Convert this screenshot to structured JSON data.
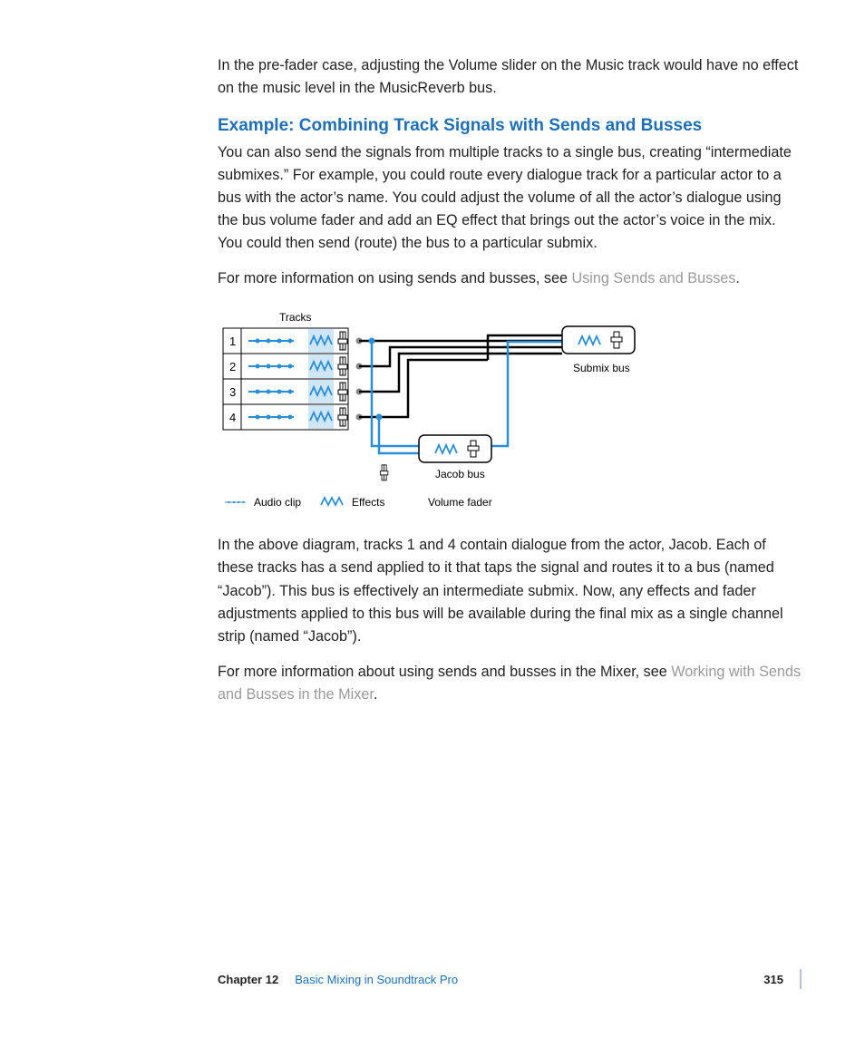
{
  "intro_para": "In the pre-fader case, adjusting the Volume slider on the Music track would have no effect on the music level in the MusicReverb bus.",
  "section_title": "Example: Combining Track Signals with Sends and Busses",
  "para1": "You can also send the signals from multiple tracks to a single bus, creating “intermediate submixes.” For example, you could route every dialogue track for a particular actor to a bus with the actor’s name. You could adjust the volume of all the actor’s dialogue using the bus volume fader and add an EQ effect that brings out the actor’s voice in the mix. You could then send (route) the bus to a particular submix.",
  "para2_a": "For more information on using sends and busses, see ",
  "para2_link": "Using Sends and Busses",
  "para3": "In the above diagram, tracks 1 and 4 contain dialogue from the actor, Jacob. Each of these tracks has a send applied to it that taps the signal and routes it to a bus (named “Jacob”). This bus is effectively an intermediate submix. Now, any effects and fader adjustments applied to this bus will be available during the final mix as a single channel strip (named “Jacob”).",
  "para4_a": "For more information about using sends and busses in the Mixer, see ",
  "para4_link": "Working with Sends and Busses in the Mixer",
  "diagram": {
    "tracks_label": "Tracks",
    "track_numbers": [
      "1",
      "2",
      "3",
      "4"
    ],
    "submix_label": "Submix bus",
    "jacob_label": "Jacob bus",
    "legend": {
      "audio": "Audio clip",
      "effects": "Effects",
      "fader": "Volume fader"
    }
  },
  "footer": {
    "chapter": "Chapter 12",
    "title": "Basic Mixing in Soundtrack Pro",
    "page": "315"
  }
}
